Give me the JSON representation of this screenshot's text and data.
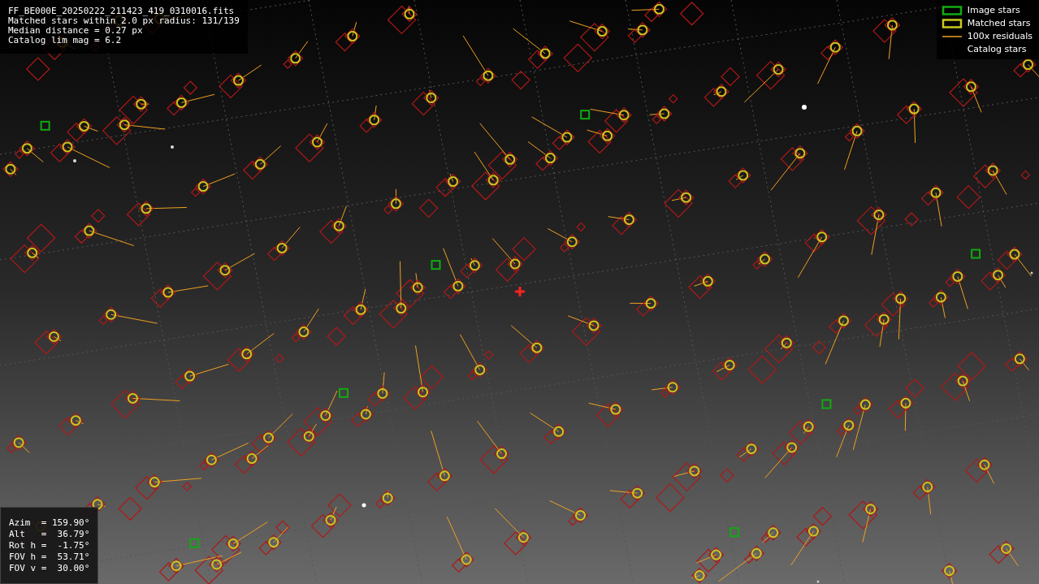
{
  "info": {
    "lines": [
      "FF_BE000E_20250222_211423_419_0310016.fits",
      "Matched stars within 2.0 px radius: 131/139",
      "Median distance = 0.27 px",
      "Catalog lim mag = 6.2"
    ]
  },
  "legend": [
    {
      "kind": "image",
      "label": "Image stars"
    },
    {
      "kind": "matched",
      "label": "Matched stars"
    },
    {
      "kind": "residual",
      "label": "100x residuals"
    },
    {
      "kind": "catalog",
      "label": "Catalog stars"
    }
  ],
  "pointing": {
    "lines": [
      "Azim  = 159.90°",
      "Alt   =  36.79°",
      "Rot h =  -1.75°",
      "FOV h =  53.71°",
      "FOV v =  30.00°"
    ]
  }
}
